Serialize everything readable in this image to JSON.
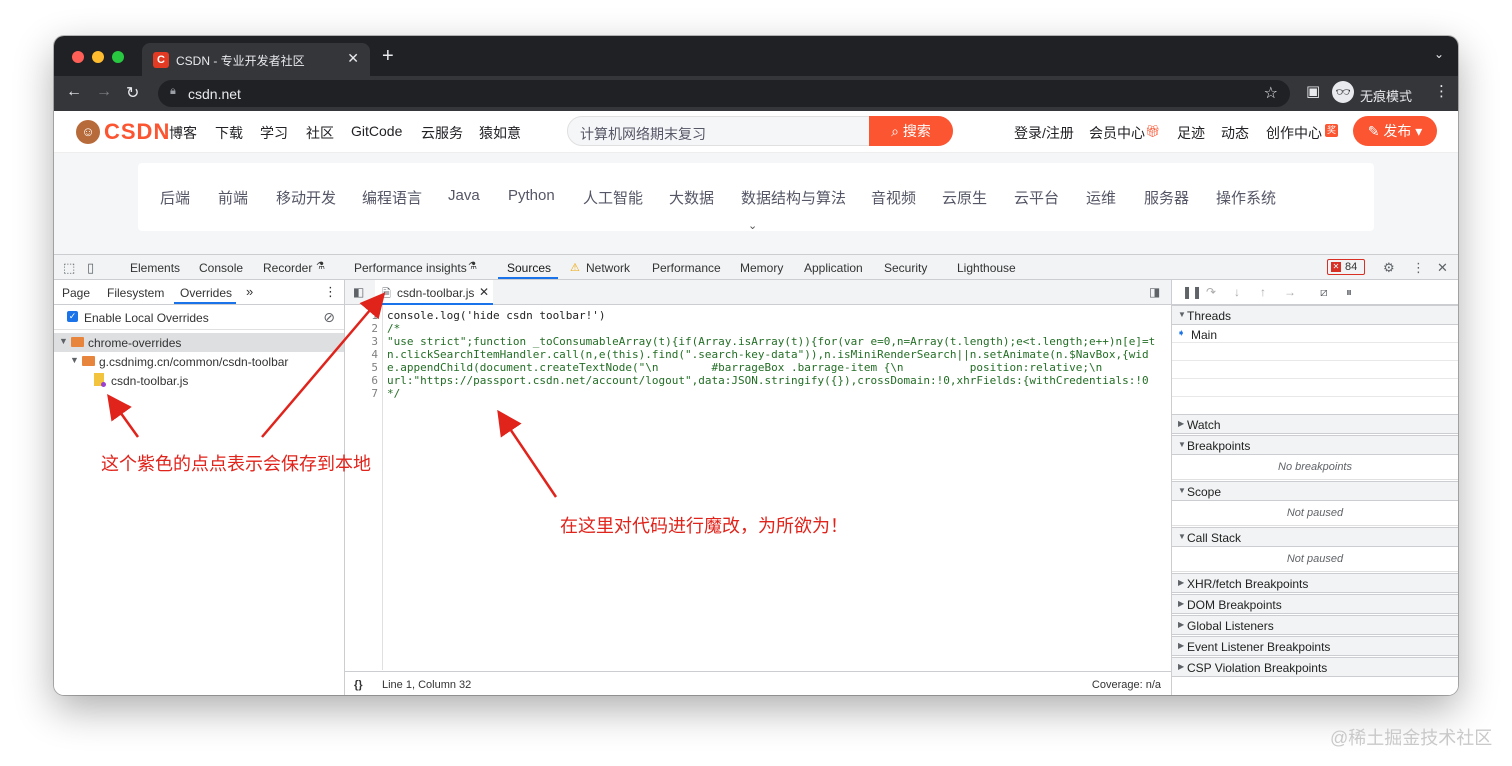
{
  "browser": {
    "tab_title": "CSDN - 专业开发者社区",
    "tab_favicon": "C",
    "url": "csdn.net",
    "incognito_label": "无痕模式",
    "icons": [
      "back-icon",
      "forward-icon",
      "reload-icon",
      "lock-icon",
      "star-icon",
      "sidepanel-icon",
      "incognito-icon",
      "menu-icon"
    ]
  },
  "csdn": {
    "nav": [
      "博客",
      "下载",
      "学习",
      "社区",
      "GitCode",
      "云服务",
      "猿如意"
    ],
    "search_placeholder": "计算机网络期末复习",
    "search_button": "搜索",
    "right_links": [
      "登录/注册",
      "会员中心",
      "足迹",
      "动态",
      "创作中心"
    ],
    "publish_button": "发布",
    "categories": [
      "后端",
      "前端",
      "移动开发",
      "编程语言",
      "Java",
      "Python",
      "人工智能",
      "大数据",
      "数据结构与算法",
      "音视频",
      "云原生",
      "云平台",
      "运维",
      "服务器",
      "操作系统"
    ]
  },
  "devtools": {
    "tabs": [
      "Elements",
      "Console",
      "Recorder",
      "Performance insights",
      "Sources",
      "Network",
      "Performance",
      "Memory",
      "Application",
      "Security",
      "Lighthouse"
    ],
    "active_tab": "Sources",
    "error_count": "84",
    "navigator_tabs": [
      "Page",
      "Filesystem",
      "Overrides"
    ],
    "active_navigator_tab": "Overrides",
    "enable_local_overrides": "Enable Local Overrides",
    "tree": {
      "root": "chrome-overrides",
      "folder": "g.csdnimg.cn/common/csdn-toolbar",
      "file": "csdn-toolbar.js"
    },
    "editor_tab": "csdn-toolbar.js",
    "code_lines": [
      {
        "n": "1",
        "text": "console.log('hide csdn toolbar!')"
      },
      {
        "n": "2",
        "text": "/*"
      },
      {
        "n": "3",
        "text": "\"use strict\";function _toConsumableArray(t){if(Array.isArray(t)){for(var e=0,n=Array(t.length);e<t.length;e++)n[e]=t"
      },
      {
        "n": "4",
        "text": "n.clickSearchItemHandler.call(n,e(this).find(\".search-key-data\")),n.isMiniRenderSearch||n.setAnimate(n.$NavBox,{wid"
      },
      {
        "n": "5",
        "text": "e.appendChild(document.createTextNode(\"\\n        #barrageBox .barrage-item {\\n          position:relative;\\n"
      },
      {
        "n": "6",
        "text": "url:\"https://passport.csdn.net/account/logout\",data:JSON.stringify({}),crossDomain:!0,xhrFields:{withCredentials:!0"
      },
      {
        "n": "7",
        "text": "*/"
      }
    ],
    "status_position": "Line 1, Column 32",
    "status_coverage": "Coverage: n/a",
    "status_braces": "{}",
    "debugger": {
      "threads": "Threads",
      "thread_main": "Main",
      "watch": "Watch",
      "breakpoints": "Breakpoints",
      "no_breakpoints": "No breakpoints",
      "scope": "Scope",
      "scope_body": "Not paused",
      "call_stack": "Call Stack",
      "call_stack_body": "Not paused",
      "collapsed": [
        "XHR/fetch Breakpoints",
        "DOM Breakpoints",
        "Global Listeners",
        "Event Listener Breakpoints",
        "CSP Violation Breakpoints"
      ]
    }
  },
  "annotations": {
    "dot_note": "这个紫色的点点表示会保存到本地",
    "edit_note": "在这里对代码进行魔改，为所欲为！",
    "color": "#e0231b"
  },
  "watermark": "@稀土掘金技术社区"
}
